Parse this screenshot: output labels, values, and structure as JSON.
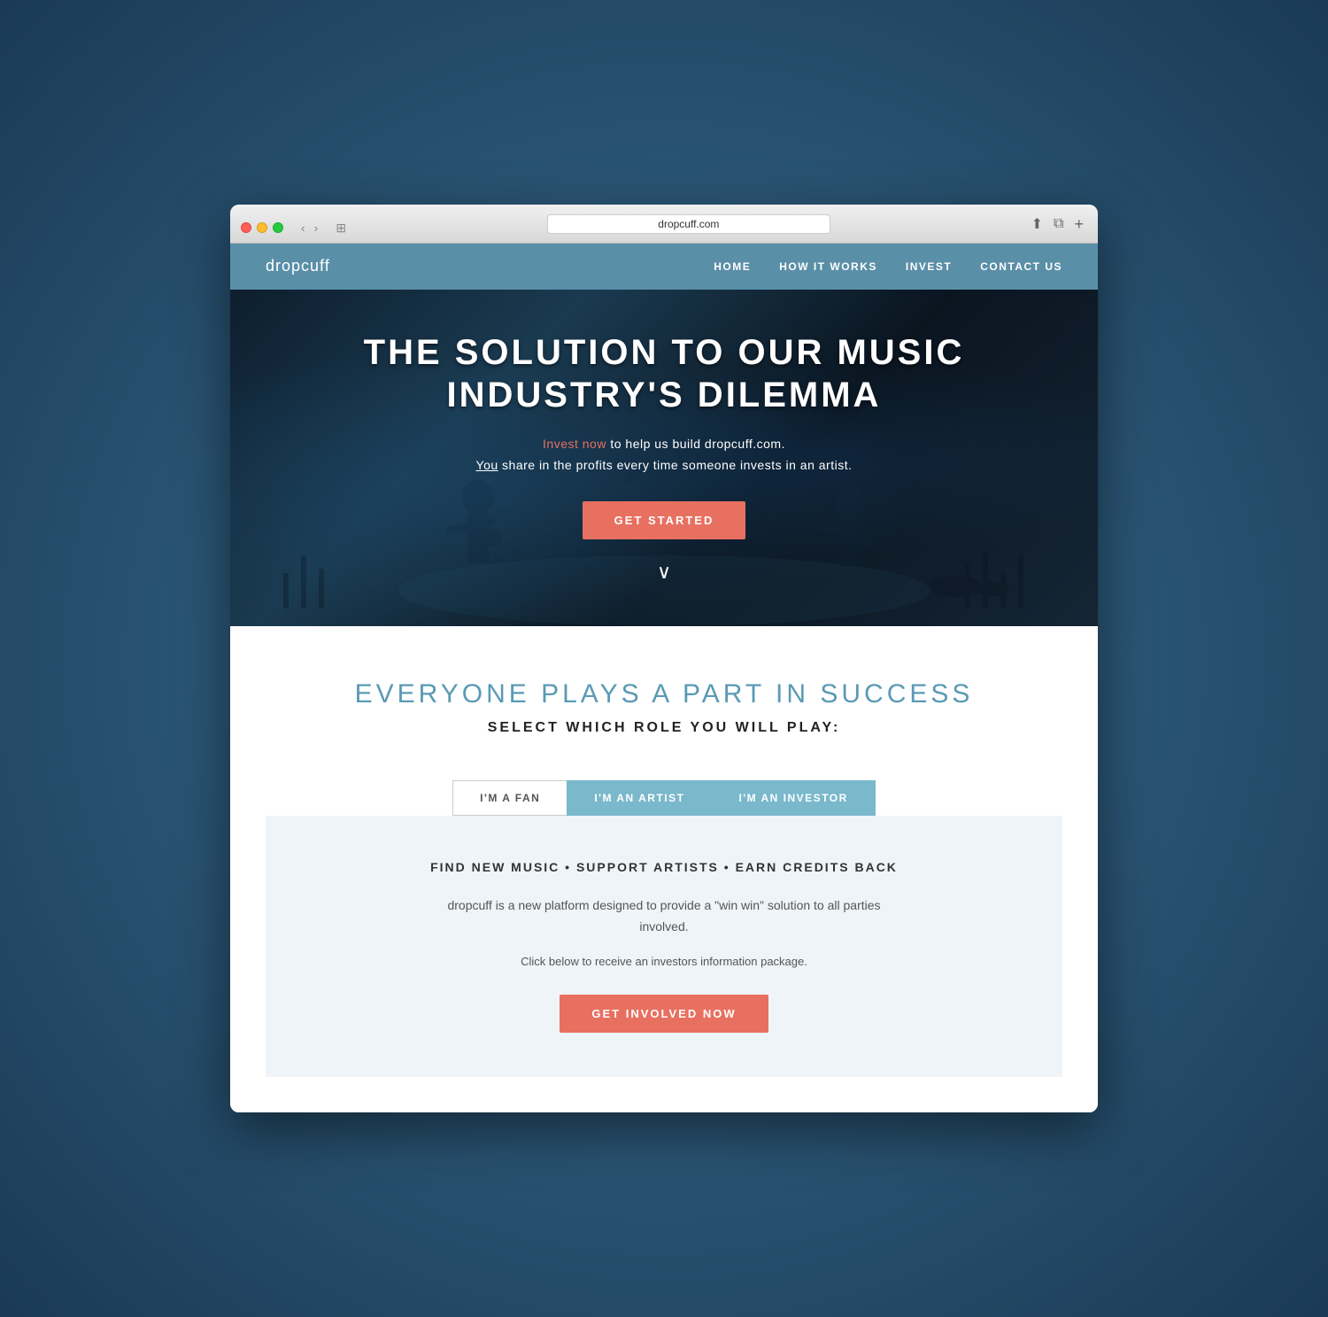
{
  "browser": {
    "url": "dropcuff.com",
    "traffic_lights": {
      "close": "close",
      "minimize": "minimize",
      "maximize": "maximize"
    }
  },
  "navbar": {
    "brand": "dropcuff",
    "links": [
      {
        "label": "HOME",
        "id": "home"
      },
      {
        "label": "HOW IT WORKS",
        "id": "how-it-works"
      },
      {
        "label": "INVEST",
        "id": "invest"
      },
      {
        "label": "CONTACT US",
        "id": "contact-us"
      }
    ]
  },
  "hero": {
    "title_line1": "THE SOLUTION TO OUR MUSIC",
    "title_line2": "INDUSTRY'S DILEMMA",
    "subtitle_invest": "Invest now",
    "subtitle_rest": " to help us build dropcuff.com.",
    "subtitle_line2_start": "You",
    "subtitle_line2_rest": " share in the profits every time someone invests in an artist.",
    "cta_label": "GET STARTED",
    "chevron": "∨"
  },
  "main": {
    "section_title": "EVERYONE PLAYS A PART IN SUCCESS",
    "section_subtitle": "SELECT WHICH ROLE YOU WILL PLAY:",
    "tabs": [
      {
        "label": "I'M A FAN",
        "id": "fan",
        "active": false
      },
      {
        "label": "I'M AN ARTIST",
        "id": "artist",
        "active": true
      },
      {
        "label": "I'M AN INVESTOR",
        "id": "investor",
        "active": true
      }
    ],
    "tab_content": {
      "tagline": "FIND NEW MUSIC • SUPPORT ARTISTS • EARN CREDITS BACK",
      "description": "dropcuff is a new platform designed to provide a \"win win\" solution to all parties involved.",
      "cta_text": "Click below to receive an investors information package.",
      "cta_button": "GET INVOLVED NOW"
    }
  },
  "colors": {
    "coral": "#e87060",
    "blue": "#5a8fa8",
    "light_blue": "#7ab8cc",
    "tab_bg": "#eef4f8"
  }
}
